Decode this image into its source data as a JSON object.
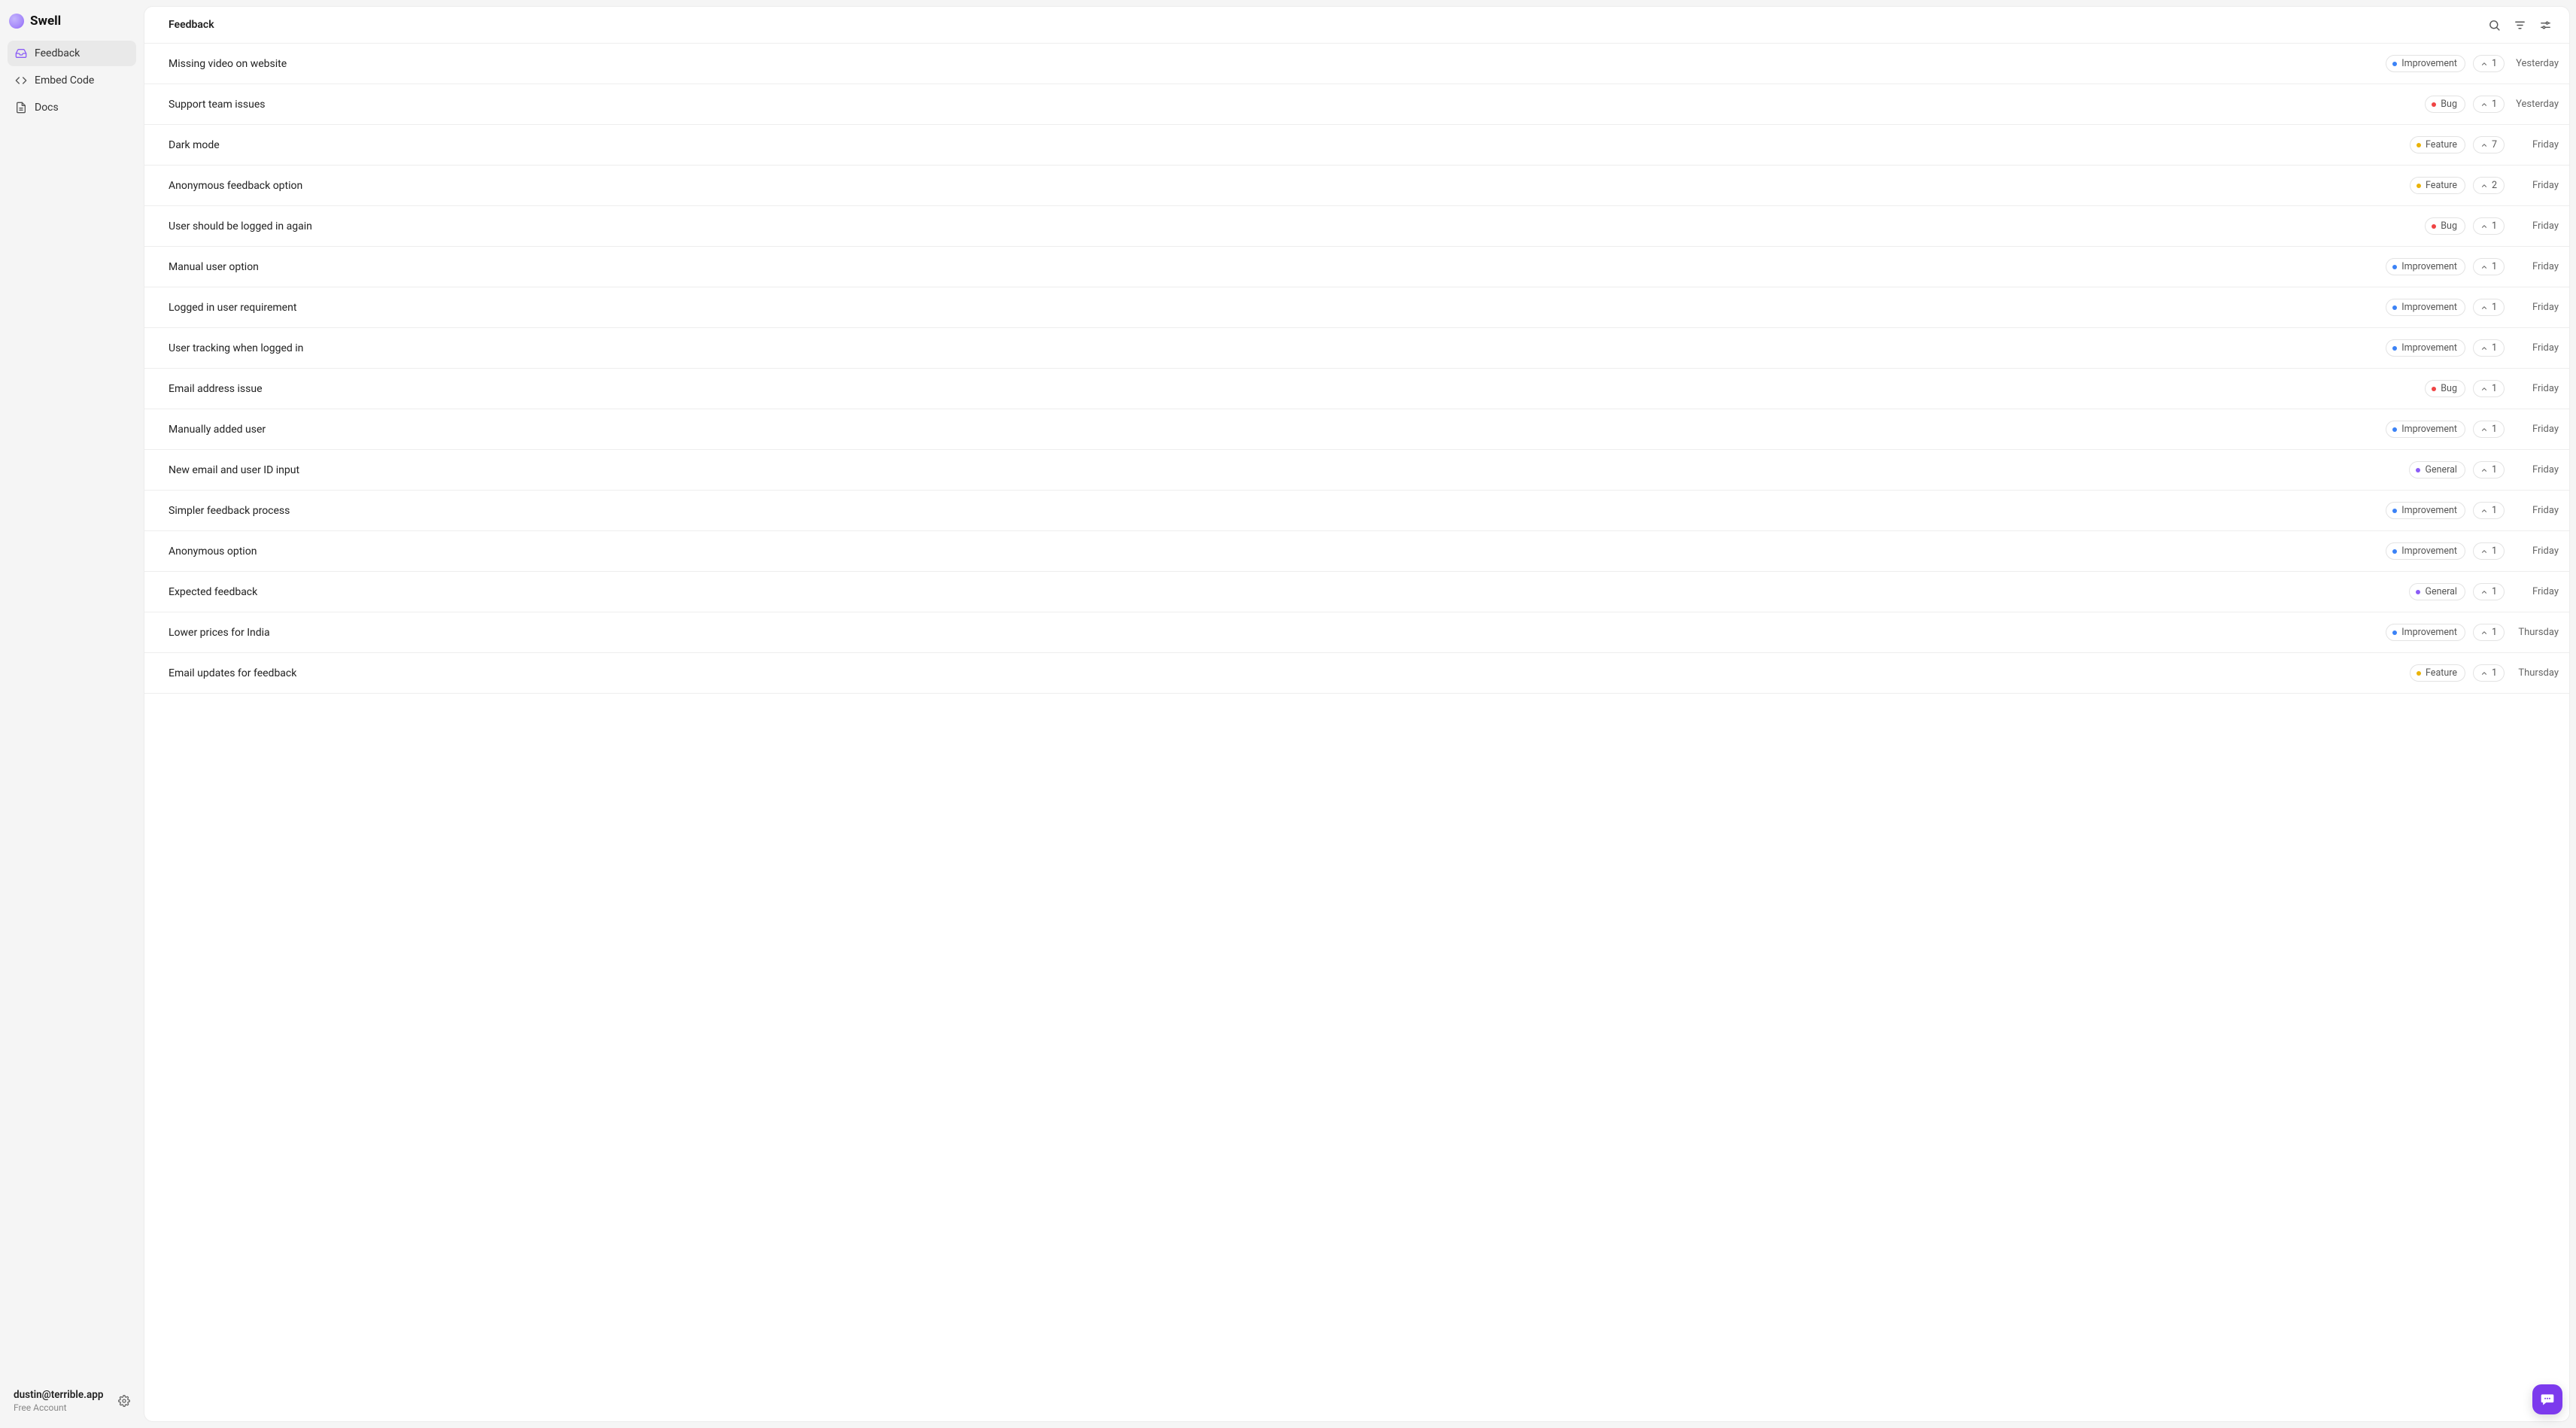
{
  "brand": {
    "name": "Swell"
  },
  "nav": {
    "items": [
      {
        "label": "Feedback",
        "icon": "inbox-icon",
        "active": true
      },
      {
        "label": "Embed Code",
        "icon": "code-icon",
        "active": false
      },
      {
        "label": "Docs",
        "icon": "doc-icon",
        "active": false
      }
    ]
  },
  "account": {
    "email": "dustin@terrible.app",
    "plan": "Free Account"
  },
  "header": {
    "title": "Feedback"
  },
  "category_colors": {
    "Improvement": "#3b82f6",
    "Bug": "#ef4444",
    "Feature": "#eab308",
    "General": "#8b5cf6"
  },
  "feedback": [
    {
      "title": "Missing video on website",
      "category": "Improvement",
      "upvotes": 1,
      "date": "Yesterday"
    },
    {
      "title": "Support team issues",
      "category": "Bug",
      "upvotes": 1,
      "date": "Yesterday"
    },
    {
      "title": "Dark mode",
      "category": "Feature",
      "upvotes": 7,
      "date": "Friday"
    },
    {
      "title": "Anonymous feedback option",
      "category": "Feature",
      "upvotes": 2,
      "date": "Friday"
    },
    {
      "title": "User should be logged in again",
      "category": "Bug",
      "upvotes": 1,
      "date": "Friday"
    },
    {
      "title": "Manual user option",
      "category": "Improvement",
      "upvotes": 1,
      "date": "Friday"
    },
    {
      "title": "Logged in user requirement",
      "category": "Improvement",
      "upvotes": 1,
      "date": "Friday"
    },
    {
      "title": "User tracking when logged in",
      "category": "Improvement",
      "upvotes": 1,
      "date": "Friday"
    },
    {
      "title": "Email address issue",
      "category": "Bug",
      "upvotes": 1,
      "date": "Friday"
    },
    {
      "title": "Manually added user",
      "category": "Improvement",
      "upvotes": 1,
      "date": "Friday"
    },
    {
      "title": "New email and user ID input",
      "category": "General",
      "upvotes": 1,
      "date": "Friday"
    },
    {
      "title": "Simpler feedback process",
      "category": "Improvement",
      "upvotes": 1,
      "date": "Friday"
    },
    {
      "title": "Anonymous option",
      "category": "Improvement",
      "upvotes": 1,
      "date": "Friday"
    },
    {
      "title": "Expected feedback",
      "category": "General",
      "upvotes": 1,
      "date": "Friday"
    },
    {
      "title": "Lower prices for India",
      "category": "Improvement",
      "upvotes": 1,
      "date": "Thursday"
    },
    {
      "title": "Email updates for feedback",
      "category": "Feature",
      "upvotes": 1,
      "date": "Thursday"
    }
  ]
}
